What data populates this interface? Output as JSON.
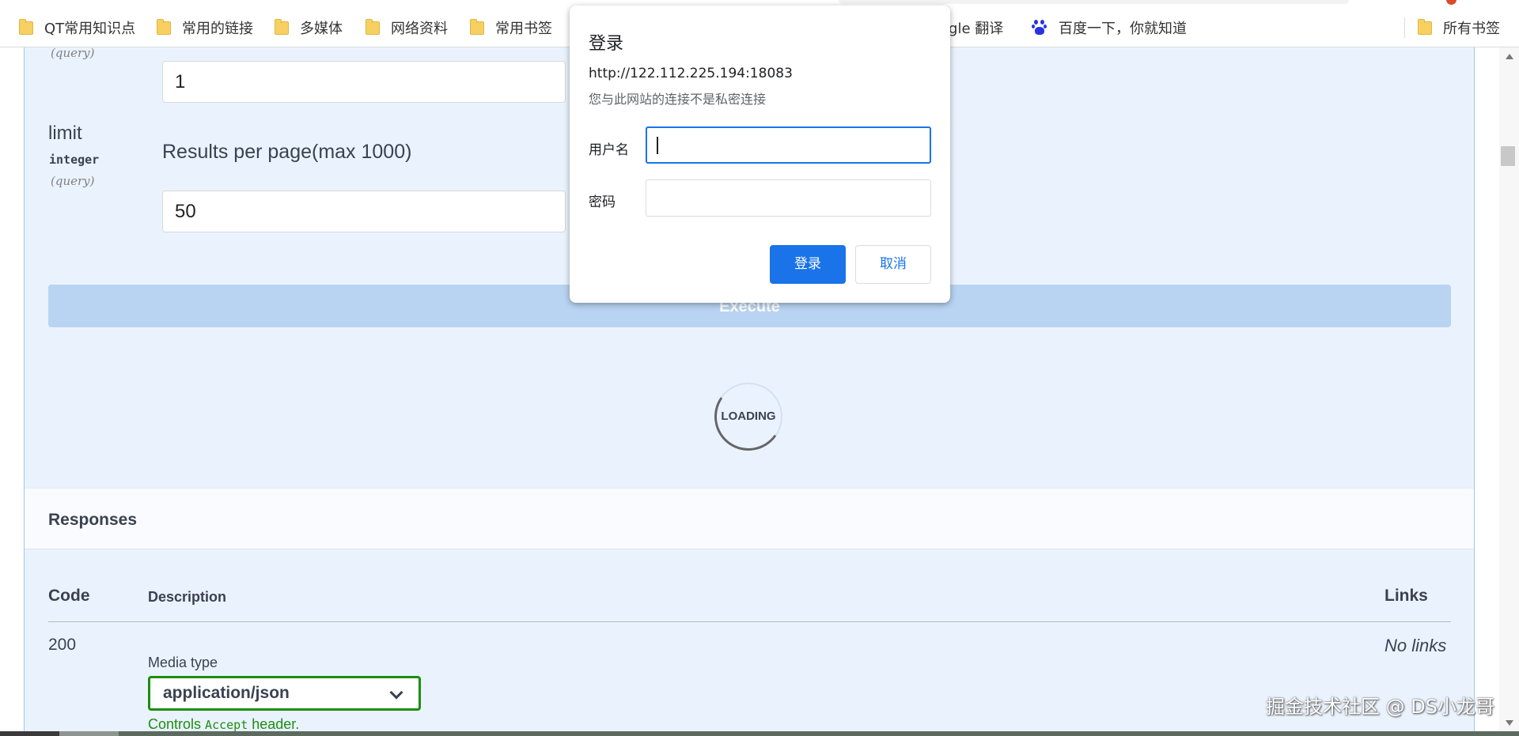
{
  "bookmarks": {
    "items": [
      {
        "label": "QT常用知识点",
        "icon": "folder-icon"
      },
      {
        "label": "常用的链接",
        "icon": "folder-icon"
      },
      {
        "label": "多媒体",
        "icon": "folder-icon"
      },
      {
        "label": "网络资料",
        "icon": "folder-icon"
      },
      {
        "label": "常用书签",
        "icon": "folder-icon"
      },
      {
        "label": "ogle 翻译",
        "icon": ""
      },
      {
        "label": "百度一下，你就知道",
        "icon": "baidu-icon"
      }
    ],
    "all_bookmarks": "所有书签"
  },
  "params": {
    "page_in": "(query)",
    "page_value": "1",
    "limit": {
      "name": "limit",
      "type": "integer",
      "in": "(query)",
      "description": "Results per page(max 1000)",
      "value": "50"
    }
  },
  "execute_label": "Execute",
  "loading_text": "LOADING",
  "responses": {
    "title": "Responses",
    "headers": {
      "code": "Code",
      "description": "Description",
      "links": "Links"
    },
    "rows": [
      {
        "code": "200",
        "links": "No links",
        "media_type_label": "Media type",
        "media_type": "application/json",
        "controls_pre": "Controls",
        "controls_code": "Accept",
        "controls_post": "header."
      }
    ]
  },
  "watermark": "掘金技术社区 @ DS小龙哥",
  "dialog": {
    "title": "登录",
    "url": "http://122.112.225.194:18083",
    "subtitle": "您与此网站的连接不是私密连接",
    "username_label": "用户名",
    "username_value": "",
    "password_label": "密码",
    "password_value": "",
    "login_button": "登录",
    "cancel_button": "取消"
  },
  "colors": {
    "page_bg": "#eaf3fd",
    "execute_bg": "#b8d4f2",
    "media_border": "#1d8d0f",
    "dialog_primary": "#1a73e8"
  }
}
